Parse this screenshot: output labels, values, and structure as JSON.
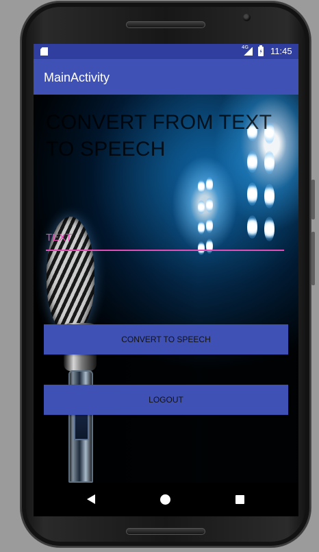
{
  "status_bar": {
    "network": "4G",
    "time": "11:45"
  },
  "app_bar": {
    "title": "MainActivity"
  },
  "main": {
    "heading": "CONVERT FROM TEXT TO SPEECH",
    "text_input": {
      "value": "",
      "placeholder": "TEXT"
    },
    "convert_button": "CONVERT TO SPEECH",
    "logout_button": "LOGOUT"
  },
  "colors": {
    "status_bar": "#303f9f",
    "app_bar": "#3f51b5",
    "accent": "#e24db6",
    "button": "#3f51b5"
  },
  "icons": {
    "sim": "sim-card-icon",
    "signal": "cell-signal-icon",
    "battery": "battery-charging-icon",
    "back": "back-icon",
    "home": "home-icon",
    "recents": "recents-icon"
  }
}
